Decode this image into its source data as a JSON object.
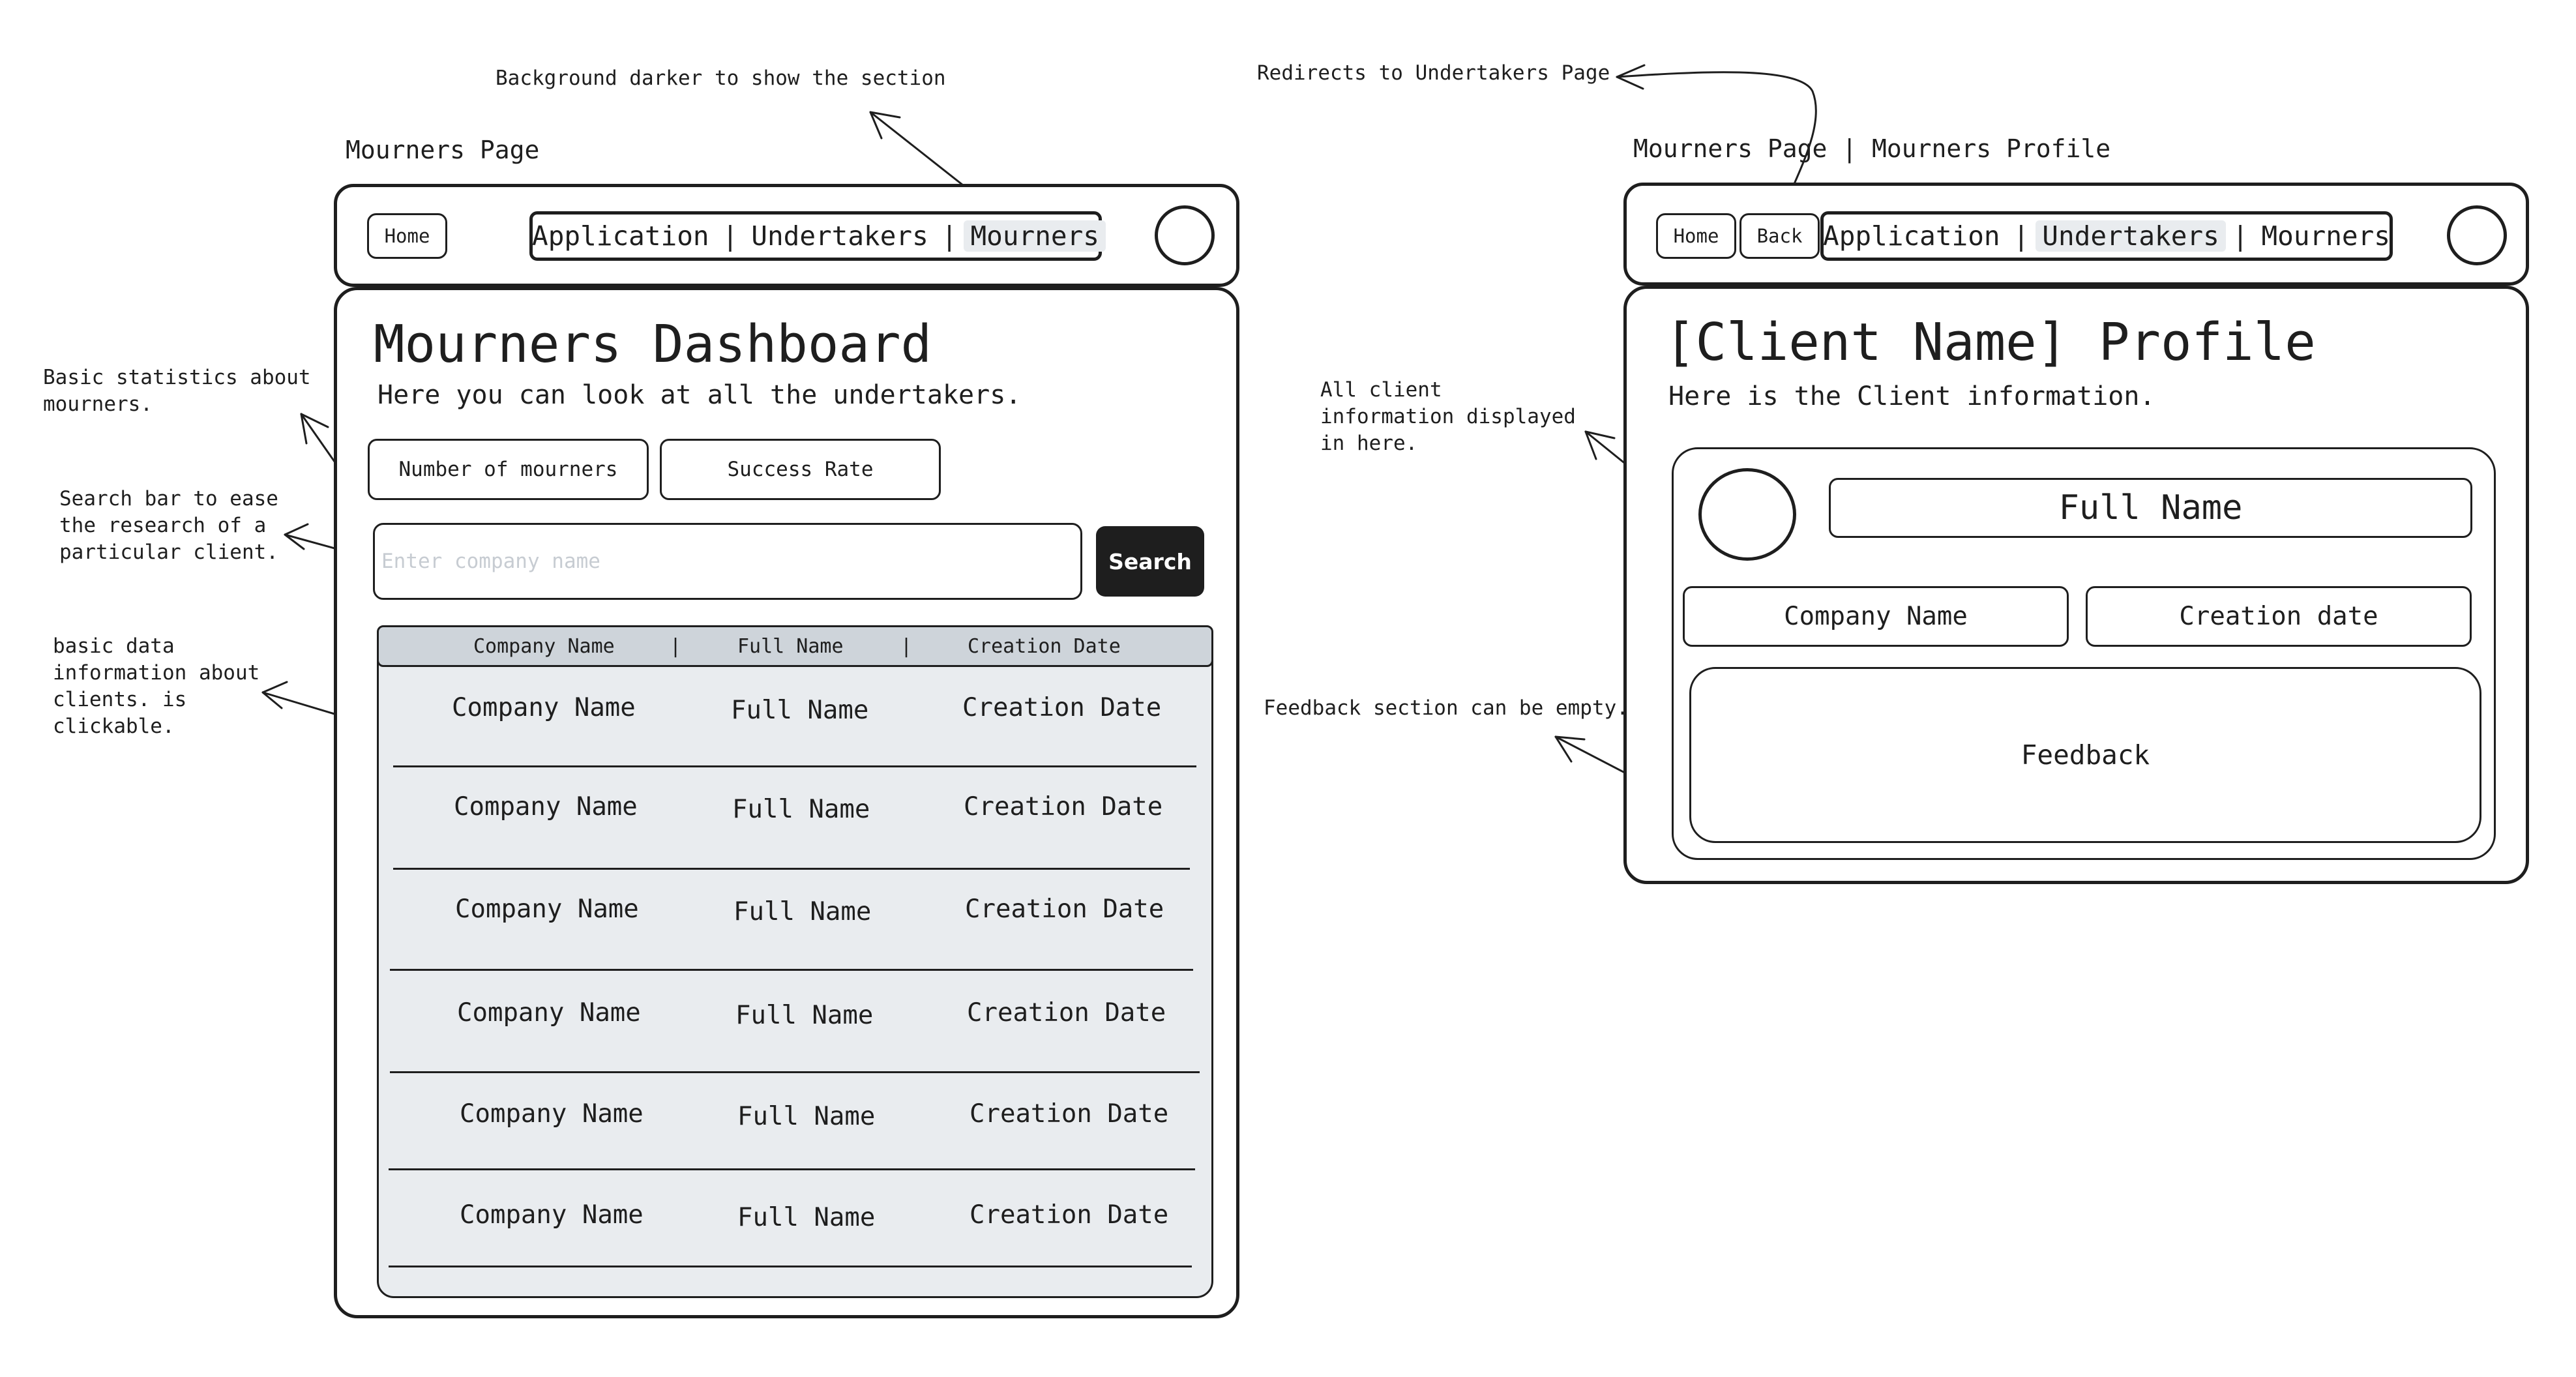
{
  "annotations": {
    "background_darker": "Background darker to show the section",
    "redirects": "Redirects to Undertakers Page",
    "basic_statistics": "Basic statistics about\nmourners.",
    "search_bar": "Search bar to ease\nthe research of a\nparticular client.",
    "basic_data": "basic data\ninformation about\nclients. is\nclickable.",
    "all_client_info": "All client\ninformation displayed\nin here.",
    "feedback_empty": "Feedback section can be empty."
  },
  "dashboard": {
    "page_label": "Mourners Page",
    "nav": {
      "home": "Home",
      "links": [
        "Application",
        "|",
        "Undertakers",
        "|",
        "Mourners"
      ]
    },
    "title": "Mourners Dashboard",
    "subtitle": "Here you can look at all the undertakers.",
    "stats": {
      "mourners_count": "Number of mourners",
      "success_rate": "Success Rate"
    },
    "search": {
      "placeholder": "Enter company name",
      "button": "Search"
    },
    "table": {
      "headers": [
        "Company Name",
        "|",
        "Full Name",
        "|",
        "Creation Date"
      ],
      "rows": [
        [
          "Company Name",
          "Full Name",
          "Creation Date"
        ],
        [
          "Company Name",
          "Full Name",
          "Creation Date"
        ],
        [
          "Company Name",
          "Full Name",
          "Creation Date"
        ],
        [
          "Company Name",
          "Full Name",
          "Creation Date"
        ],
        [
          "Company Name",
          "Full Name",
          "Creation Date"
        ],
        [
          "Company Name",
          "Full Name",
          "Creation Date"
        ]
      ]
    }
  },
  "profile": {
    "page_label": "Mourners Page | Mourners Profile",
    "nav": {
      "home": "Home",
      "back": "Back",
      "links": [
        "Application",
        "|",
        "Undertakers",
        "|",
        "Mourners"
      ]
    },
    "title": "[Client Name] Profile",
    "subtitle": "Here is the Client information.",
    "full_name": "Full Name",
    "company_name": "Company Name",
    "creation_date": "Creation date",
    "feedback": "Feedback"
  },
  "colors": {
    "ink": "#1e1e1e",
    "table_bg": "#e9ecef",
    "table_header_bg": "#ced4da",
    "nav_highlight": "#e9ecef",
    "placeholder": "#c7ccd2"
  }
}
